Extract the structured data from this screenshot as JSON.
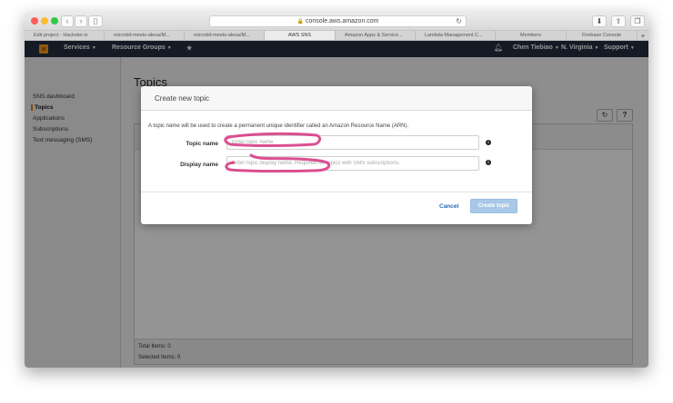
{
  "browser": {
    "address": "console.aws.amazon.com",
    "tabs": [
      {
        "label": "Edit project - Hackster.io"
      },
      {
        "label": "microbit-meets-alexa/M..."
      },
      {
        "label": "microbit-meets-alexa/M..."
      },
      {
        "label": "AWS SNS"
      },
      {
        "label": "Amazon Apps & Service..."
      },
      {
        "label": "Lambda Management C..."
      },
      {
        "label": "Members"
      },
      {
        "label": "Firebase Console"
      }
    ],
    "new_tab": "+"
  },
  "aws_nav": {
    "services": "Services",
    "resource_groups": "Resource Groups",
    "user": "Chen Tiebiao",
    "region": "N. Virginia",
    "support": "Support"
  },
  "sidebar": {
    "items": [
      {
        "label": "SNS dashboard"
      },
      {
        "label": "Topics"
      },
      {
        "label": "Applications"
      },
      {
        "label": "Subscriptions"
      },
      {
        "label": "Text messaging (SMS)"
      }
    ],
    "collapse": "◂"
  },
  "page": {
    "title": "Topics",
    "total_items": "Total Items: 0",
    "selected_items": "Selected Items: 0"
  },
  "modal": {
    "title": "Create new topic",
    "description": "A topic name will be used to create a permanent unique identifier called an Amazon Resource Name (ARN).",
    "topic_name_label": "Topic name",
    "topic_name_placeholder": "Enter topic name.",
    "display_name_label": "Display name",
    "display_name_placeholder": "Enter topic display name. Required for topics with SMS subscriptions.",
    "info": "i",
    "cancel": "Cancel",
    "create": "Create topic"
  },
  "colors": {
    "aws_nav_bg": "#232f3e",
    "aws_orange": "#f7981d",
    "link_blue": "#236ab9",
    "annotation": "#d6317e"
  }
}
